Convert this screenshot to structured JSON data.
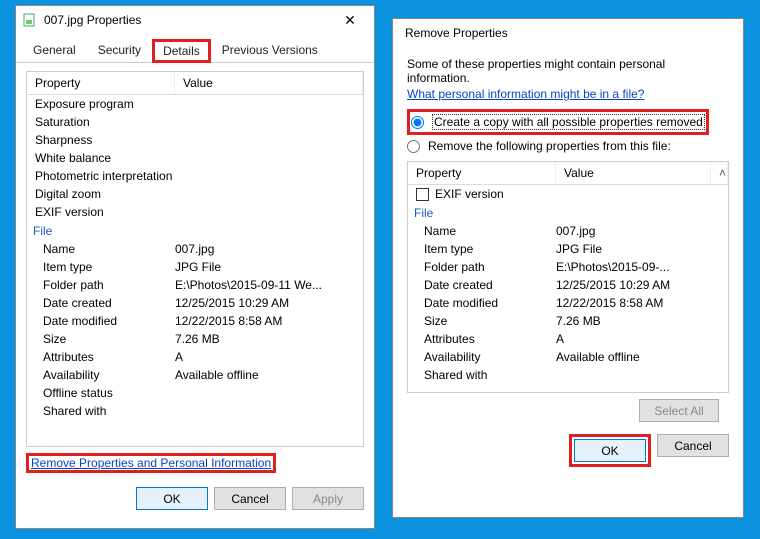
{
  "left": {
    "title": "007.jpg Properties",
    "tabs": [
      "General",
      "Security",
      "Details",
      "Previous Versions"
    ],
    "active_tab": "Details",
    "col_property": "Property",
    "col_value": "Value",
    "rows_top": [
      {
        "p": "Exposure program",
        "v": ""
      },
      {
        "p": "Saturation",
        "v": ""
      },
      {
        "p": "Sharpness",
        "v": ""
      },
      {
        "p": "White balance",
        "v": ""
      },
      {
        "p": "Photometric interpretation",
        "v": ""
      },
      {
        "p": "Digital zoom",
        "v": ""
      },
      {
        "p": "EXIF version",
        "v": ""
      }
    ],
    "section": "File",
    "rows_file": [
      {
        "p": "Name",
        "v": "007.jpg"
      },
      {
        "p": "Item type",
        "v": "JPG File"
      },
      {
        "p": "Folder path",
        "v": "E:\\Photos\\2015-09-11 We..."
      },
      {
        "p": "Date created",
        "v": "12/25/2015 10:29 AM"
      },
      {
        "p": "Date modified",
        "v": "12/22/2015 8:58 AM"
      },
      {
        "p": "Size",
        "v": "7.26 MB"
      },
      {
        "p": "Attributes",
        "v": "A"
      },
      {
        "p": "Availability",
        "v": "Available offline"
      },
      {
        "p": "Offline status",
        "v": ""
      },
      {
        "p": "Shared with",
        "v": ""
      }
    ],
    "remove_link": "Remove Properties and Personal Information",
    "ok": "OK",
    "cancel": "Cancel",
    "apply": "Apply"
  },
  "right": {
    "title": "Remove Properties",
    "intro": "Some of these properties might contain personal information.",
    "info_link": "What personal information might be in a file?",
    "radio1": "Create a copy with all possible properties removed",
    "radio2": "Remove the following properties from this file:",
    "col_property": "Property",
    "col_value": "Value",
    "exif_row": "EXIF version",
    "section": "File",
    "rows_file": [
      {
        "p": "Name",
        "v": "007.jpg"
      },
      {
        "p": "Item type",
        "v": "JPG File"
      },
      {
        "p": "Folder path",
        "v": "E:\\Photos\\2015-09-..."
      },
      {
        "p": "Date created",
        "v": "12/25/2015 10:29 AM"
      },
      {
        "p": "Date modified",
        "v": "12/22/2015 8:58 AM"
      },
      {
        "p": "Size",
        "v": "7.26 MB"
      },
      {
        "p": "Attributes",
        "v": "A"
      },
      {
        "p": "Availability",
        "v": "Available offline"
      },
      {
        "p": "Shared with",
        "v": ""
      }
    ],
    "select_all": "Select All",
    "ok": "OK",
    "cancel": "Cancel"
  }
}
